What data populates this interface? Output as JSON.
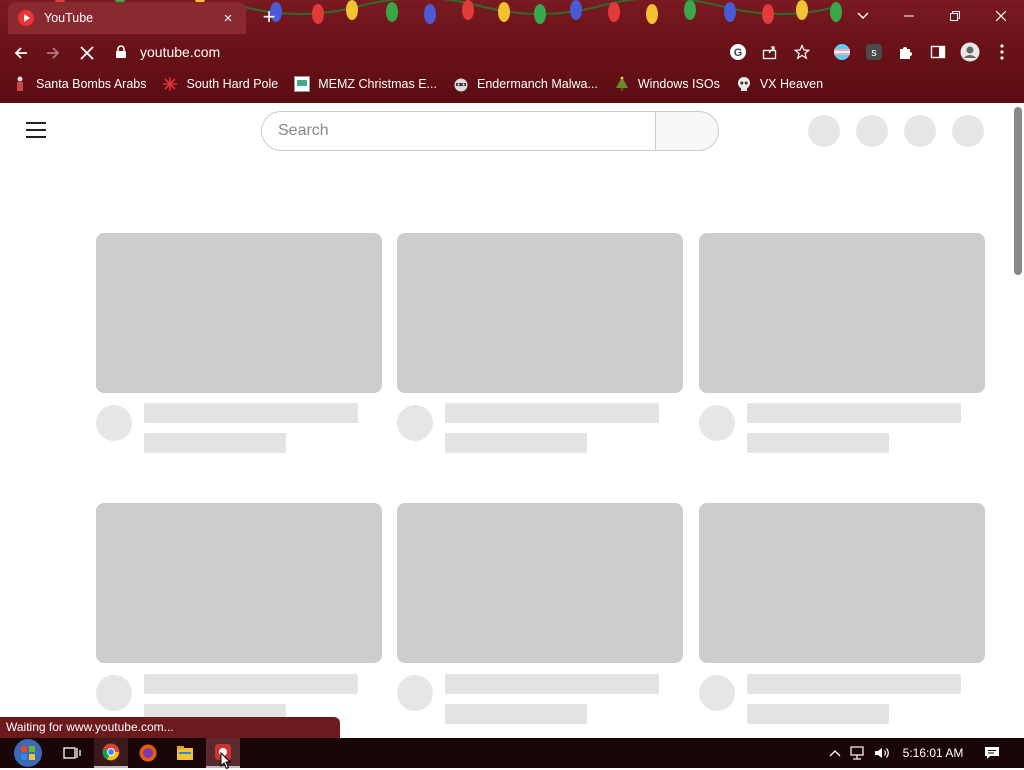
{
  "browser": {
    "tab_title": "YouTube",
    "tab_close": "×",
    "new_tab": "+",
    "url": "youtube.com",
    "bookmarks": [
      {
        "label": "Santa Bombs Arabs",
        "icon": "figure-icon"
      },
      {
        "label": "South Hard Pole",
        "icon": "snowflake-icon"
      },
      {
        "label": "MEMZ Christmas E...",
        "icon": "image-icon"
      },
      {
        "label": "Endermanch Malwa...",
        "icon": "raccoon-icon"
      },
      {
        "label": "Windows ISOs",
        "icon": "tree-icon"
      },
      {
        "label": "VX Heaven",
        "icon": "skull-icon"
      }
    ],
    "theme_colors": {
      "frame": "#6c1219",
      "tab": "#8a2a30"
    }
  },
  "youtube": {
    "search_placeholder": "Search"
  },
  "status": "Waiting for www.youtube.com...",
  "taskbar": {
    "clock": "5:16:01 AM"
  }
}
